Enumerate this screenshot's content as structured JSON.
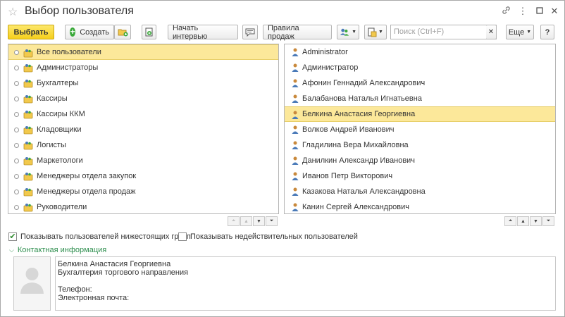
{
  "window": {
    "title": "Выбор пользователя",
    "controls": {
      "link": "🔗",
      "more": "⋮",
      "minimize": "▭",
      "close": "✕"
    }
  },
  "toolbar": {
    "select_label": "Выбрать",
    "create_label": "Создать",
    "start_interview_label": "Начать интервью",
    "sales_rules_label": "Правила продаж",
    "search_placeholder": "Поиск (Ctrl+F)",
    "more_label": "Еще",
    "help_label": "?"
  },
  "groups": {
    "items": [
      {
        "label": "Все пользователи",
        "selected": true
      },
      {
        "label": "Администраторы"
      },
      {
        "label": "Бухгалтеры"
      },
      {
        "label": "Кассиры"
      },
      {
        "label": "Кассиры ККМ"
      },
      {
        "label": "Кладовщики"
      },
      {
        "label": "Логисты"
      },
      {
        "label": "Маркетологи"
      },
      {
        "label": "Менеджеры отдела закупок"
      },
      {
        "label": "Менеджеры отдела продаж"
      },
      {
        "label": "Руководители"
      }
    ]
  },
  "users": {
    "items": [
      {
        "label": "Administrator"
      },
      {
        "label": "Администратор"
      },
      {
        "label": "Афонин Геннадий Александрович"
      },
      {
        "label": "Балабанова Наталья Игнатьевна"
      },
      {
        "label": "Белкина Анастасия Георгиевна",
        "selected": true
      },
      {
        "label": "Волков Андрей Иванович"
      },
      {
        "label": "Гладилина Вера Михайловна"
      },
      {
        "label": "Данилкин Александр Иванович"
      },
      {
        "label": "Иванов Петр Викторович"
      },
      {
        "label": "Казакова Наталья Александровна"
      },
      {
        "label": "Канин Сергей Александрович"
      }
    ]
  },
  "options": {
    "show_subgroup_users": {
      "label": "Показывать пользователей нижестоящих групп",
      "checked": true
    },
    "show_invalid_users": {
      "label": "Показывать недействительных пользователей",
      "checked": false
    }
  },
  "contact": {
    "section_title": "Контактная информация",
    "name": "Белкина Анастасия Георгиевна",
    "department": "Бухгалтерия торгового направления",
    "phone_label": "Телефон:",
    "email_label": "Электронная почта:"
  },
  "colors": {
    "primary_button": "#f5cf1c",
    "selection": "#fce89a",
    "section_title": "#2f8f4f",
    "create_icon": "#3aa93a"
  }
}
